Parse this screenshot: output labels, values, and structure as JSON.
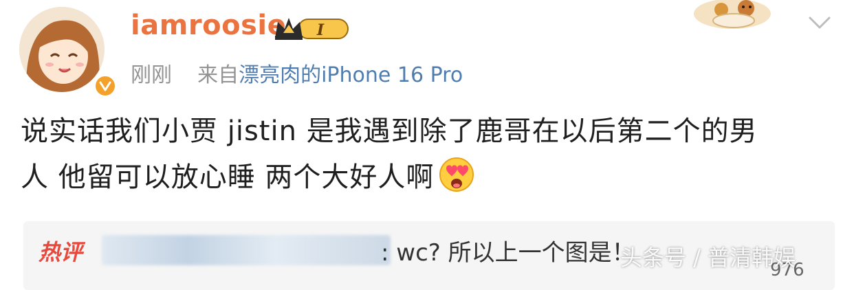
{
  "post": {
    "username": "iamroosie",
    "badge_label": "I",
    "time": "刚刚",
    "source_prefix": "来自",
    "source_device": "漂亮肉的iPhone 16 Pro",
    "content_line1": "说实话我们小贾 jistin 是我遇到除了鹿哥在以后第二个的男",
    "content_line2": "人 他留可以放心睡 两个大好人啊"
  },
  "hot_comment": {
    "tag": "热评",
    "text": ": wc?  所以上一个图是！",
    "like_count": "976"
  },
  "watermark": "头条号 / 普清韩娱",
  "icons": {
    "verified": "verified-v-icon",
    "crown": "crown-icon",
    "chevron": "chevron-down-icon",
    "emoji": "heart-eyes-emoji-icon"
  },
  "colors": {
    "username": "#eb7340",
    "source": "#507daf",
    "hot_tag": "#e8493c",
    "verified": "#f3a12b"
  }
}
